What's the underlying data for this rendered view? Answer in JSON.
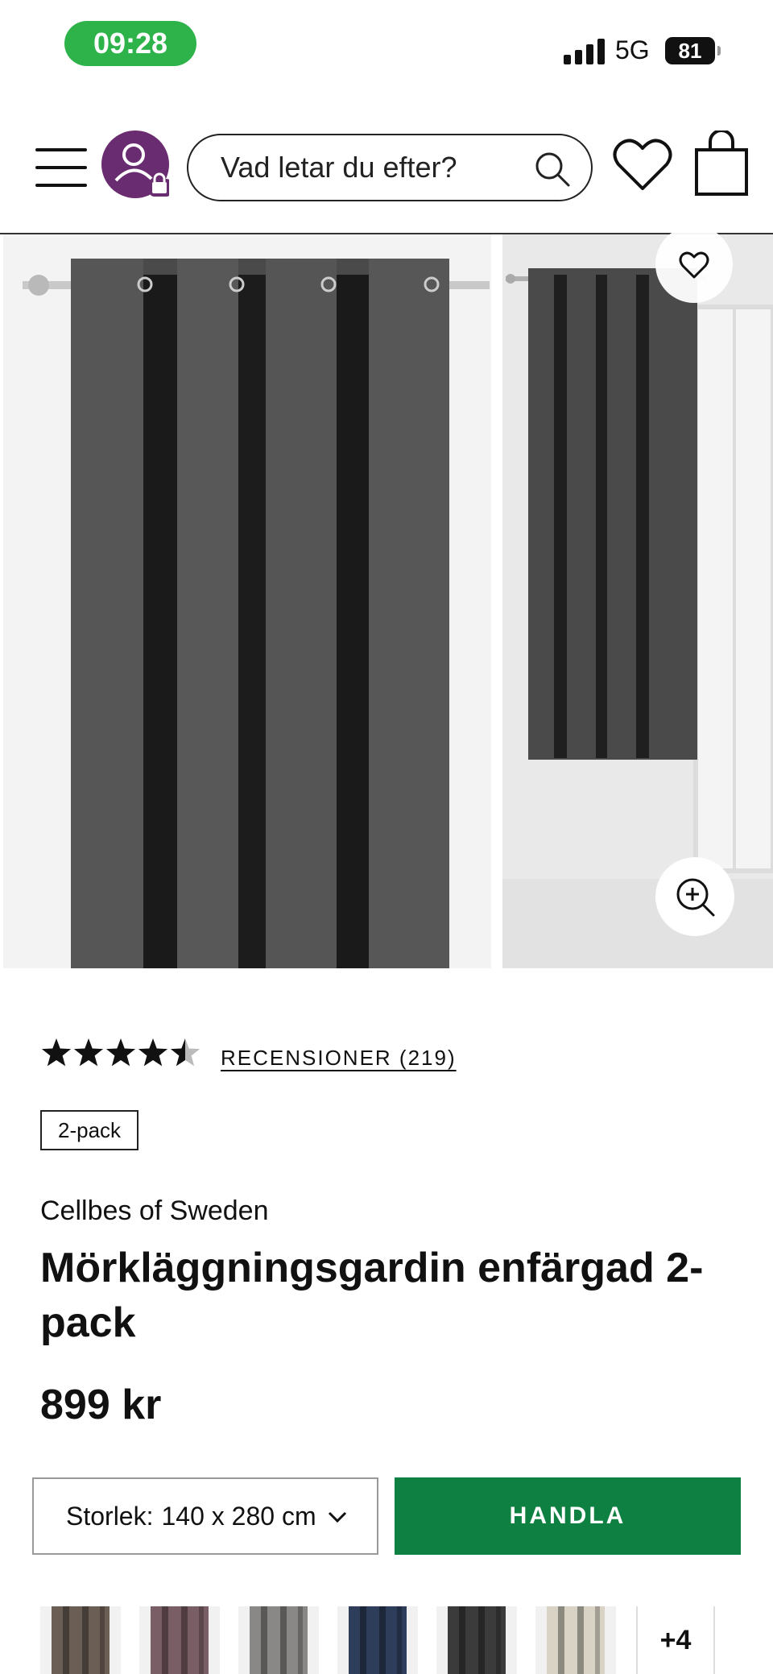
{
  "status_bar": {
    "time": "09:28",
    "network": "5G",
    "battery": "81"
  },
  "header": {
    "search_placeholder": "Vad letar du efter?"
  },
  "product": {
    "rating_stars": 4.5,
    "reviews_label": "RECENSIONER (219)",
    "badge": "2-pack",
    "brand": "Cellbes of Sweden",
    "title": "Mörkläggningsgardin enfärgad 2-pack",
    "price": "899 kr",
    "size_label": "Storlek:",
    "size_value": "140 x 280 cm",
    "buy_label": "HANDLA",
    "more_colors": "+4"
  },
  "swatches": [
    "#6b5e55",
    "#7a5e66",
    "#8a8886",
    "#2e3d5a",
    "#3b3b3b",
    "#d8d3c4"
  ],
  "colors": {
    "accent": "#0e8041",
    "avatar": "#6a2c70",
    "status": "#2db34a",
    "curtain": "#4a4a4a"
  }
}
